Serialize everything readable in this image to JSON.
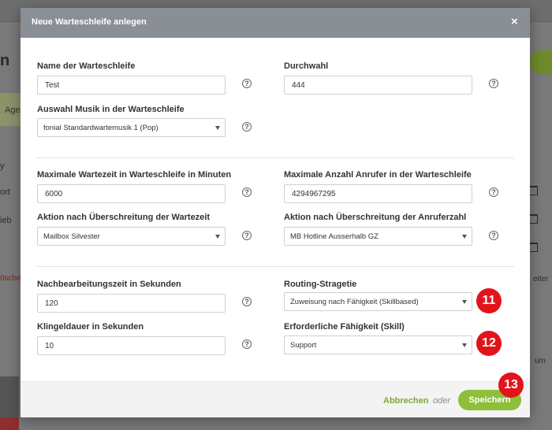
{
  "background": {
    "heading": "n",
    "band_text": "Age",
    "left_items": [
      "y",
      "ort",
      "ieb"
    ],
    "red_text": "öschen",
    "right_items": [
      "eiter",
      "um"
    ]
  },
  "modal": {
    "title": "Neue Warteschleife anlegen",
    "close_icon": "×",
    "fields": {
      "name": {
        "label": "Name der Warteschleife",
        "value": "Test"
      },
      "durchwahl": {
        "label": "Durchwahl",
        "value": "444"
      },
      "musik": {
        "label": "Auswahl Musik in der Warteschleife",
        "value": "fonial Standardwartemusik 1 (Pop)"
      },
      "max_wartezeit": {
        "label": "Maximale Wartezeit in Warteschleife in Minuten",
        "value": "6000"
      },
      "max_anrufer": {
        "label": "Maximale Anzahl Anrufer in der Warteschleife",
        "value": "4294967295"
      },
      "aktion_wartezeit": {
        "label": "Aktion nach Überschreitung der Wartezeit",
        "value": "Mailbox Silvester"
      },
      "aktion_anrufer": {
        "label": "Aktion nach Überschreitung der Anruferzahl",
        "value": "MB Hotline Ausserhalb GZ"
      },
      "nachbearbeitung": {
        "label": "Nachbearbeitungszeit in Sekunden",
        "value": "120"
      },
      "routing": {
        "label": "Routing-Stragetie",
        "value": "Zuweisung nach Fähigkeit (Skillbased)"
      },
      "klingeldauer": {
        "label": "Klingeldauer in Sekunden",
        "value": "10"
      },
      "skill": {
        "label": "Erforderliche Fähigkeit (Skill)",
        "value": "Support"
      }
    },
    "help_glyph": "?",
    "footer": {
      "cancel_label": "Abbrechen",
      "or_label": "oder",
      "save_label": "Speichern"
    }
  },
  "badges": [
    "11",
    "12",
    "13"
  ],
  "colors": {
    "header": "#8a8f96",
    "accent_green": "#8cbf3a",
    "link_green": "#7fa834",
    "badge_red": "#e3131b"
  }
}
